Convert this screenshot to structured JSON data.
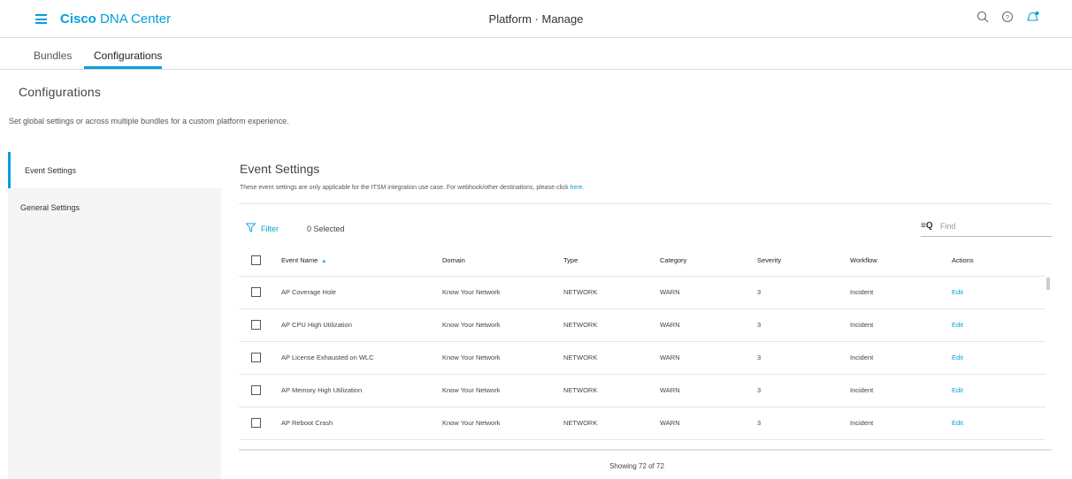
{
  "header": {
    "brand_bold": "Cisco",
    "brand_rest": " DNA Center",
    "title": "Platform · Manage",
    "icons": [
      "search-icon",
      "help-icon",
      "notification-icon"
    ]
  },
  "tabs": [
    {
      "label": "Bundles",
      "active": false
    },
    {
      "label": "Configurations",
      "active": true
    }
  ],
  "page": {
    "title": "Configurations",
    "description": "Set global settings or across multiple bundles for a custom platform experience."
  },
  "sidebar": {
    "items": [
      {
        "label": "Event Settings",
        "active": true
      },
      {
        "label": "General Settings",
        "active": false
      }
    ]
  },
  "section": {
    "title": "Event Settings",
    "note": "These event settings are only applicable for the ITSM integration use case. For webhook/other destinations, please click ",
    "note_link": "here."
  },
  "toolbar": {
    "filter_label": "Filter",
    "selected_label": "0 Selected",
    "find_placeholder": "Find"
  },
  "table": {
    "columns": [
      "Event Name",
      "Domain",
      "Type",
      "Category",
      "Severity",
      "Workflow",
      "Actions"
    ],
    "sort_column": "Event Name",
    "rows": [
      {
        "name": "AP Coverage Hole",
        "domain": "Know Your Network",
        "type": "NETWORK",
        "category": "WARN",
        "severity": "3",
        "workflow": "Incident",
        "action": "Edit"
      },
      {
        "name": "AP CPU High Utilization",
        "domain": "Know Your Network",
        "type": "NETWORK",
        "category": "WARN",
        "severity": "3",
        "workflow": "Incident",
        "action": "Edit"
      },
      {
        "name": "AP License Exhausted on WLC",
        "domain": "Know Your Network",
        "type": "NETWORK",
        "category": "WARN",
        "severity": "3",
        "workflow": "Incident",
        "action": "Edit"
      },
      {
        "name": "AP Memory High Utilization",
        "domain": "Know Your Network",
        "type": "NETWORK",
        "category": "WARN",
        "severity": "3",
        "workflow": "Incident",
        "action": "Edit"
      },
      {
        "name": "AP Reboot Crash",
        "domain": "Know Your Network",
        "type": "NETWORK",
        "category": "WARN",
        "severity": "3",
        "workflow": "Incident",
        "action": "Edit"
      }
    ]
  },
  "footer": {
    "showing": "Showing 72 of 72"
  },
  "colors": {
    "accent": "#049fd9"
  }
}
